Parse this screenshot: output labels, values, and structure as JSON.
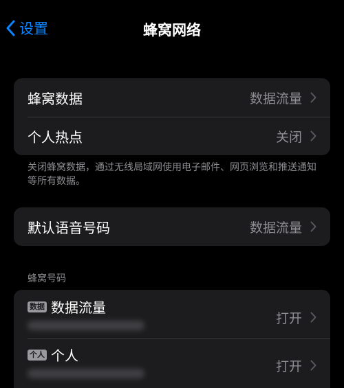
{
  "navbar": {
    "back_label": "设置",
    "title": "蜂窝网络"
  },
  "group1": {
    "rows": [
      {
        "label": "蜂窝数据",
        "value": "数据流量"
      },
      {
        "label": "个人热点",
        "value": "关闭"
      }
    ],
    "footnote": "关闭蜂窝数据，通过无线局域网使用电子邮件、网页浏览和推送通知等所有数据。"
  },
  "group2": {
    "rows": [
      {
        "label": "默认语音号码",
        "value": "数据流量"
      }
    ]
  },
  "sims": {
    "header": "蜂窝号码",
    "items": [
      {
        "badge": "数据",
        "name": "数据流量",
        "value": "打开"
      },
      {
        "badge": "个人",
        "name": "个人",
        "value": "打开"
      }
    ]
  },
  "colors": {
    "accent": "#0a84ff",
    "background": "#000000",
    "cell": "#1c1c1e",
    "secondary_text": "#8e8e93"
  }
}
